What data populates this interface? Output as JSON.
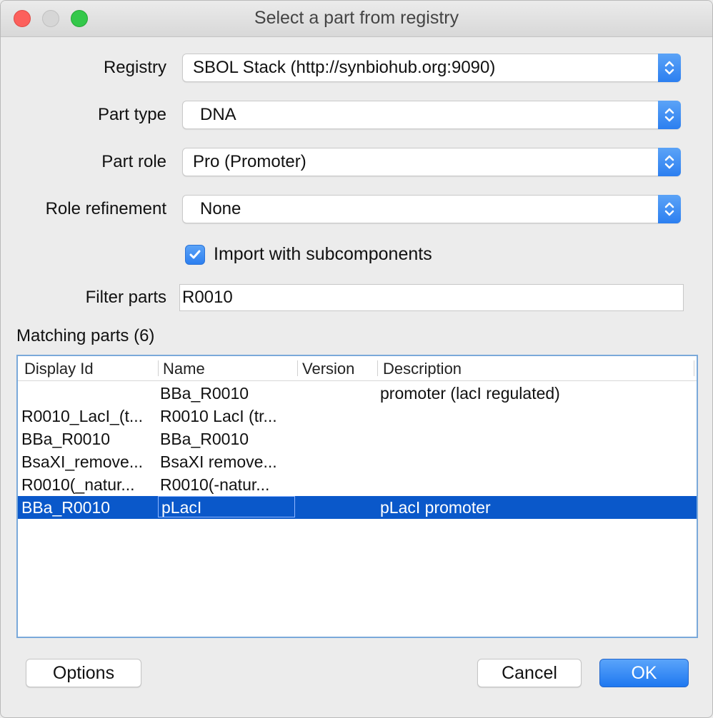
{
  "window": {
    "title": "Select a part from registry"
  },
  "form": {
    "registry": {
      "label": "Registry",
      "value": "SBOL Stack (http://synbiohub.org:9090)"
    },
    "part_type": {
      "label": "Part type",
      "value": "DNA"
    },
    "part_role": {
      "label": "Part role",
      "value": "Pro (Promoter)"
    },
    "role_refinement": {
      "label": "Role refinement",
      "value": "None"
    },
    "import_subcomponents": {
      "label": "Import with subcomponents",
      "checked": true
    },
    "filter": {
      "label": "Filter parts",
      "value": "R0010"
    }
  },
  "matching": {
    "label": "Matching parts (6)"
  },
  "table": {
    "headers": [
      "Display Id",
      "Name",
      "Version",
      "Description"
    ],
    "rows": [
      {
        "display_id": "",
        "name": "BBa_R0010",
        "version": "",
        "description": "promoter (lacI regulated)"
      },
      {
        "display_id": "R0010_LacI_(t...",
        "name": "R0010 LacI (tr...",
        "version": "",
        "description": ""
      },
      {
        "display_id": "BBa_R0010",
        "name": "BBa_R0010",
        "version": "",
        "description": ""
      },
      {
        "display_id": "BsaXI_remove...",
        "name": "BsaXI remove...",
        "version": "",
        "description": ""
      },
      {
        "display_id": "R0010(_natur...",
        "name": "R0010(-natur...",
        "version": "",
        "description": ""
      },
      {
        "display_id": "BBa_R0010",
        "name": "pLacI",
        "version": "",
        "description": "pLacI promoter",
        "selected": true
      }
    ]
  },
  "buttons": {
    "options": "Options",
    "cancel": "Cancel",
    "ok": "OK"
  },
  "colors": {
    "accent": "#2c7ff0",
    "selection": "#0a58ca",
    "close": "#fc605c",
    "maximize": "#34c84a"
  }
}
